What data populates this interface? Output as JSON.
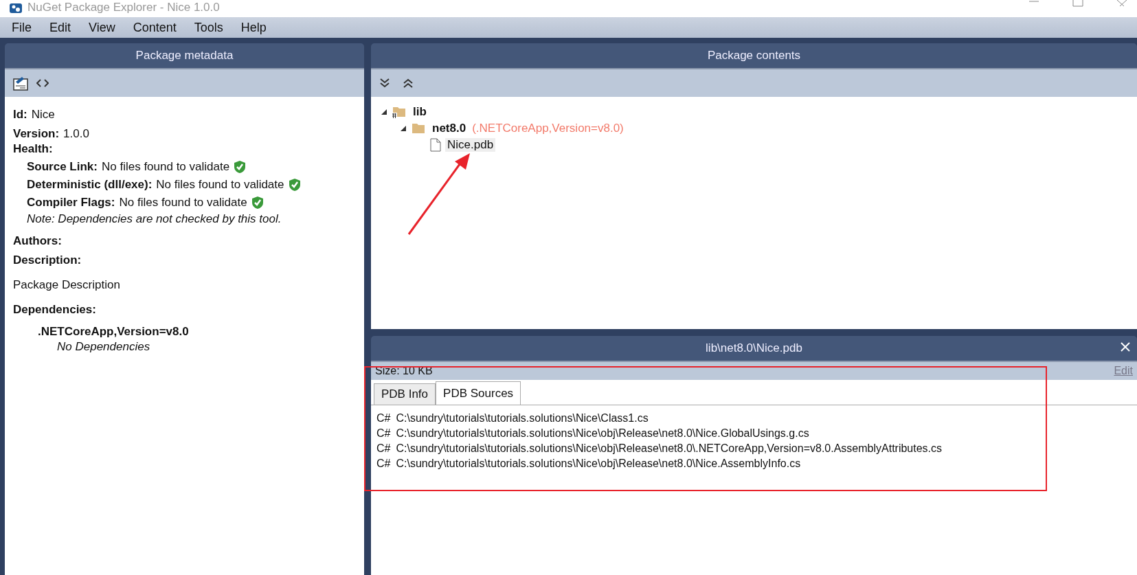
{
  "window": {
    "title": "NuGet Package Explorer - Nice 1.0.0"
  },
  "menu": [
    "File",
    "Edit",
    "View",
    "Content",
    "Tools",
    "Help"
  ],
  "metadata_panel": {
    "title": "Package metadata",
    "fields": [
      {
        "label": "Id:",
        "value": "Nice"
      },
      {
        "label": "Version:",
        "value": "1.0.0"
      }
    ],
    "health": {
      "label": "Health:",
      "checks": [
        {
          "label": "Source Link:",
          "value": "No files found to validate",
          "passed": true
        },
        {
          "label": "Deterministic (dll/exe):",
          "value": "No files found to validate",
          "passed": true
        },
        {
          "label": "Compiler Flags:",
          "value": "No files found to validate",
          "passed": true
        }
      ],
      "note": "Note: Dependencies are not checked by this tool."
    },
    "authors_label": "Authors:",
    "description_label": "Description:",
    "description": "Package Description",
    "dependencies_label": "Dependencies:",
    "dependency_groups": [
      {
        "framework": ".NETCoreApp,Version=v8.0",
        "note": "No Dependencies"
      }
    ]
  },
  "contents_panel": {
    "title": "Package contents",
    "tree": [
      {
        "name": "lib",
        "kind": "lib",
        "expanded": true,
        "selected": false,
        "children": [
          {
            "name": "net8.0",
            "kind": "folder",
            "framework": "(.NETCoreApp,Version=v8.0)",
            "expanded": true,
            "selected": false,
            "children": [
              {
                "name": "Nice.pdb",
                "kind": "file",
                "selected": true
              }
            ]
          }
        ]
      }
    ]
  },
  "file_pane": {
    "title": "lib\\net8.0\\Nice.pdb",
    "size": "Size: 10 KB",
    "edit_link": "Edit",
    "tabs": [
      {
        "label": "PDB Info",
        "selected": false
      },
      {
        "label": "PDB Sources",
        "selected": true
      }
    ],
    "sources": [
      {
        "lang": "C#",
        "path": "C:\\sundry\\tutorials\\tutorials.solutions\\Nice\\Class1.cs"
      },
      {
        "lang": "C#",
        "path": "C:\\sundry\\tutorials\\tutorials.solutions\\Nice\\obj\\Release\\net8.0\\Nice.GlobalUsings.g.cs"
      },
      {
        "lang": "C#",
        "path": "C:\\sundry\\tutorials\\tutorials.solutions\\Nice\\obj\\Release\\net8.0\\.NETCoreApp,Version=v8.0.AssemblyAttributes.cs"
      },
      {
        "lang": "C#",
        "path": "C:\\sundry\\tutorials\\tutorials.solutions\\Nice\\obj\\Release\\net8.0\\Nice.AssemblyInfo.cs"
      }
    ]
  }
}
